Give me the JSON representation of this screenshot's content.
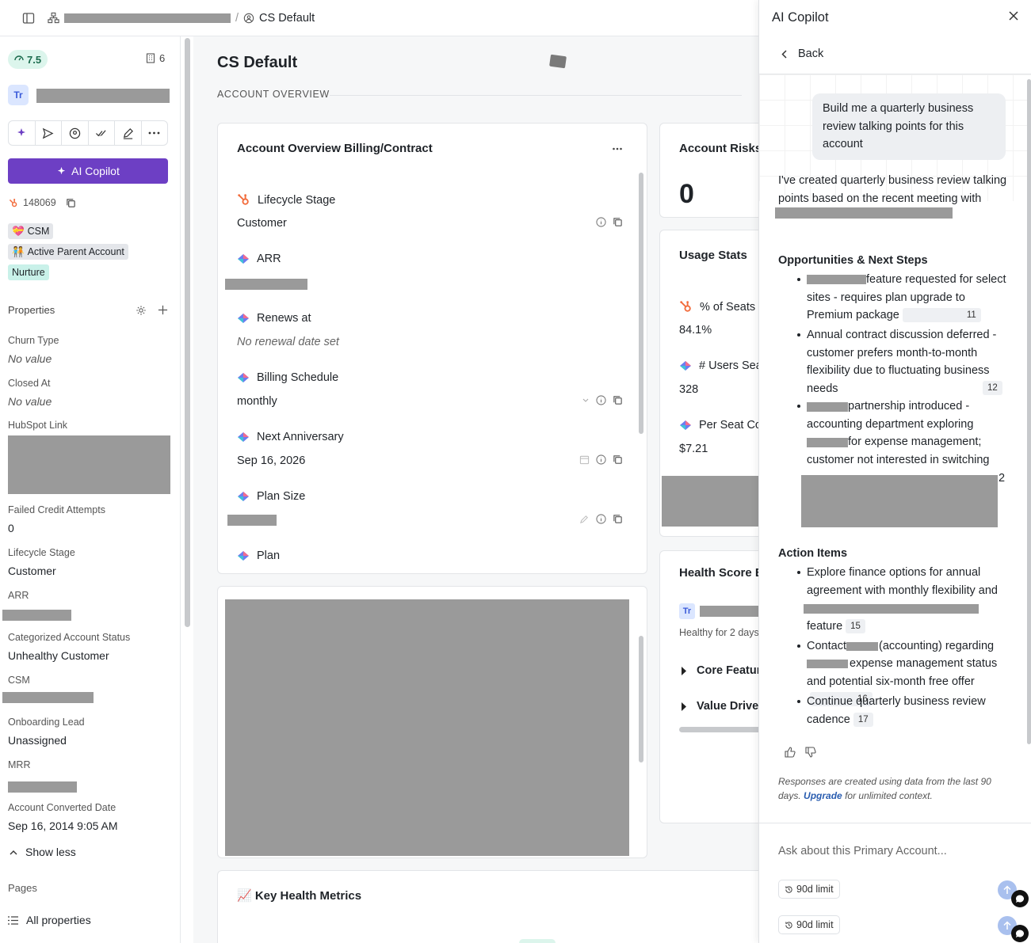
{
  "breadcrumb": {
    "current": "CS Default"
  },
  "left": {
    "health_score": "7.5",
    "building_count": "6",
    "avatar_initials": "Tr",
    "copilot_button": "AI Copilot",
    "hubspot_id": "148069",
    "tags": [
      {
        "emoji": "💝",
        "label": "CSM",
        "color": "#e4e6ea"
      },
      {
        "emoji": "🧑‍🤝‍🧑",
        "label": "Active Parent Account",
        "color": "#e4e6ea"
      },
      {
        "emoji": "",
        "label": "Nurture",
        "color": "#c9f1e9"
      }
    ],
    "properties_header": "Properties",
    "properties": [
      {
        "label": "Churn Type",
        "value": "No value",
        "muted": true
      },
      {
        "label": "Closed At",
        "value": "No value",
        "muted": true
      },
      {
        "label": "HubSpot Link",
        "value": ""
      },
      {
        "label": "Failed Credit Attempts",
        "value": "0"
      },
      {
        "label": "Lifecycle Stage",
        "value": "Customer"
      },
      {
        "label": "ARR",
        "value": ""
      },
      {
        "label": "Categorized Account Status",
        "value": "Unhealthy Customer"
      },
      {
        "label": "CSM",
        "value": ""
      },
      {
        "label": "Onboarding Lead",
        "value": "Unassigned"
      },
      {
        "label": "MRR",
        "value": ""
      },
      {
        "label": "Account Converted Date",
        "value": "Sep 16, 2014 9:05 AM"
      }
    ],
    "show_less": "Show less",
    "pages_label": "Pages",
    "all_properties": "All properties"
  },
  "main": {
    "title": "CS Default",
    "section": "ACCOUNT OVERVIEW",
    "billing_card": {
      "title": "Account Overview Billing/Contract",
      "fields": [
        {
          "label": "Lifecycle Stage",
          "value": "Customer",
          "muted": false,
          "source": "hubspot"
        },
        {
          "label": "ARR",
          "value": "",
          "muted": false,
          "source": "diamond"
        },
        {
          "label": "Renews at",
          "value": "No renewal date set",
          "muted": true,
          "source": "diamond"
        },
        {
          "label": "Billing Schedule",
          "value": "monthly",
          "muted": false,
          "source": "diamond"
        },
        {
          "label": "Next Anniversary",
          "value": "Sep 16, 2026",
          "muted": false,
          "source": "diamond"
        },
        {
          "label": "Plan Size",
          "value": "",
          "muted": false,
          "source": "diamond"
        },
        {
          "label": "Plan",
          "value": "",
          "muted": false,
          "source": "diamond"
        }
      ]
    },
    "risks_card": {
      "title": "Account Risks",
      "count": "0"
    },
    "usage_card": {
      "title": "Usage Stats",
      "stats": [
        {
          "label": "% of Seats F",
          "value": "84.1%",
          "source": "hubspot"
        },
        {
          "label": "# Users Sea",
          "value": "328",
          "source": "diamond"
        },
        {
          "label": "Per Seat Co",
          "value": "$7.21",
          "source": "diamond"
        }
      ]
    },
    "health_card": {
      "title": "Health Score B",
      "avatar": "Tr",
      "healthy_for": "Healthy for 2 days",
      "rows": [
        "Core Featur",
        "Value Drive"
      ]
    },
    "metrics_card": {
      "title": "📈 Key Health Metrics"
    }
  },
  "copilot": {
    "title": "AI Copilot",
    "back": "Back",
    "user_message": "Build me a quarterly business review talking points for this account",
    "ai_intro": "I've created quarterly business review talking points based on the recent meeting with",
    "opportunities_heading": "Opportunities & Next Steps",
    "opportunities": [
      {
        "text": "feature requested for select sites - requires plan upgrade to Premium package",
        "cite": "11"
      },
      {
        "text": "Annual contract discussion deferred - customer prefers month-to-month flexibility due to fluctuating business needs",
        "cite": "12"
      },
      {
        "text": "partnership introduced - accounting department exploring",
        "text2": "for expense management; customer not interested in switching",
        "cite": "2"
      }
    ],
    "actions_heading": "Action Items",
    "actions": [
      {
        "text": "Explore finance options for annual agreement with monthly flexibility and",
        "text2": "feature",
        "cite": "15"
      },
      {
        "text": "Contact",
        "text2": "(accounting) regarding",
        "text3": "expense management status and potential six-month free offer",
        "cite": "16"
      },
      {
        "text": "Continue quarterly business review cadence",
        "cite": "17"
      }
    ],
    "disclaimer": "Responses are created using data from the last 90 days.",
    "upgrade": "Upgrade",
    "disclaimer_tail": "for unlimited context.",
    "input_placeholder": "Ask about this Primary Account...",
    "limit_label": "90d limit"
  },
  "colors": {
    "accent": "#6d3fc4",
    "health_bg": "#dcf5ec",
    "link": "#2a5db0"
  }
}
